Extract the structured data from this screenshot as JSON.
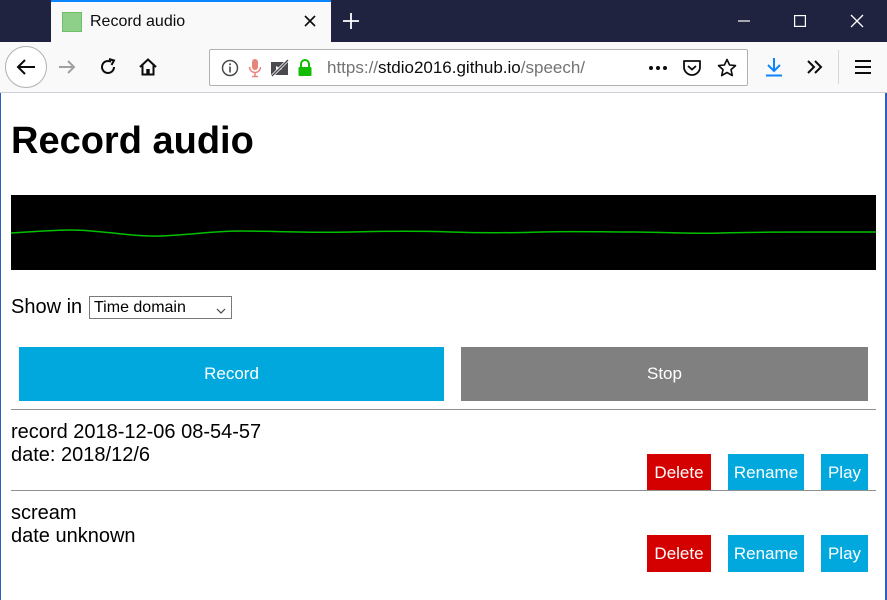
{
  "browser": {
    "tab_title": "Record audio",
    "url_scheme": "https://",
    "url_host": "stdio2016.github.io",
    "url_path": "/speech/"
  },
  "page": {
    "title": "Record audio",
    "show_in_label": "Show in",
    "view_select_value": "Time domain",
    "record_label": "Record",
    "stop_label": "Stop"
  },
  "clips": [
    {
      "name": "record 2018-12-06 08-54-57",
      "date": "date: 2018/12/6",
      "delete_label": "Delete",
      "rename_label": "Rename",
      "play_label": "Play"
    },
    {
      "name": "scream",
      "date": "date unknown",
      "delete_label": "Delete",
      "rename_label": "Rename",
      "play_label": "Play"
    }
  ],
  "colors": {
    "accent": "#00a8dd",
    "stop": "#808080",
    "delete": "#d40000",
    "waveform": "#00c000",
    "titlebar": "#202340"
  },
  "icons": {
    "tab_favicon": "favicon-icon",
    "tab_close": "close-icon",
    "new_tab": "plus-icon",
    "back": "back-arrow-icon",
    "forward": "forward-arrow-icon",
    "reload": "reload-icon",
    "home": "home-icon",
    "site_info": "info-icon",
    "microphone": "microphone-icon",
    "autoplay": "autoplay-blocked-icon",
    "lock": "lock-icon",
    "page_actions": "ellipsis-icon",
    "pocket": "pocket-icon",
    "bookmark": "star-icon",
    "downloads": "download-icon",
    "overflow": "double-chevron-icon",
    "menu": "hamburger-icon"
  }
}
